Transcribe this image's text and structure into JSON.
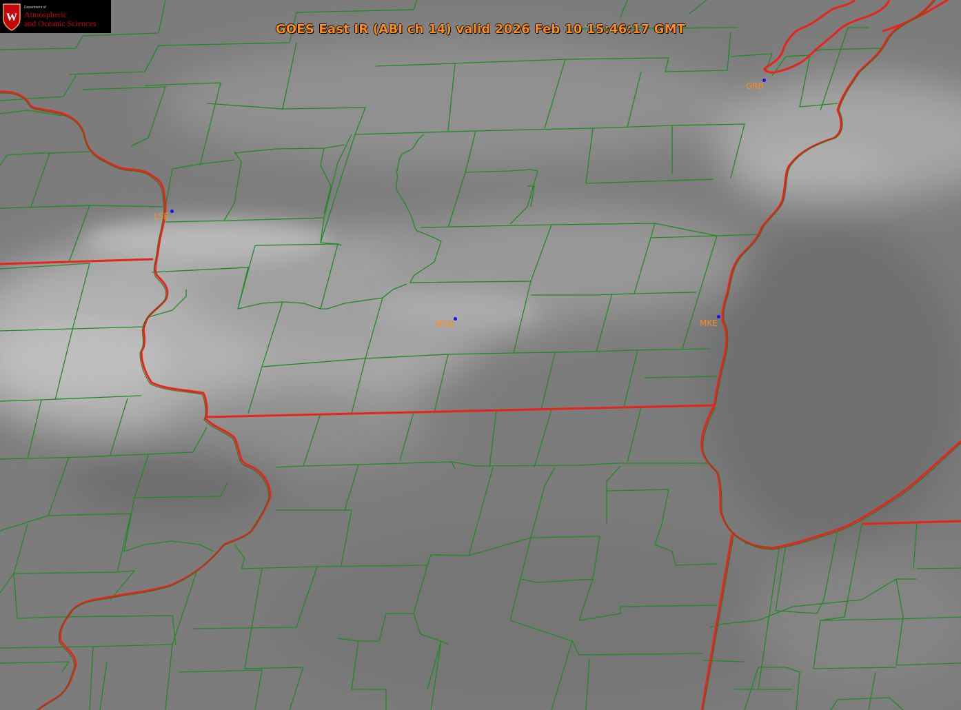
{
  "title": "GOES East IR (ABI ch 14) valid 2026 Feb 10 15:46:17 GMT",
  "logo": {
    "department": "Department of",
    "line1": "Atmospheric",
    "line2": "and Oceanic Sciences",
    "emblem": "uw-crest-icon"
  },
  "stations": [
    {
      "id": "lse",
      "label": "LSE"
    },
    {
      "id": "msn",
      "label": "MSN"
    },
    {
      "id": "mke",
      "label": "MKE"
    },
    {
      "id": "grb",
      "label": "GRB"
    }
  ],
  "colors": {
    "title": "#ff8c1a",
    "county_lines": "#1f8a1f",
    "state_lines": "#e8231a",
    "station_dot": "#1010ff",
    "station_label": "#ff8c1a",
    "logo_text": "#c5050c"
  }
}
